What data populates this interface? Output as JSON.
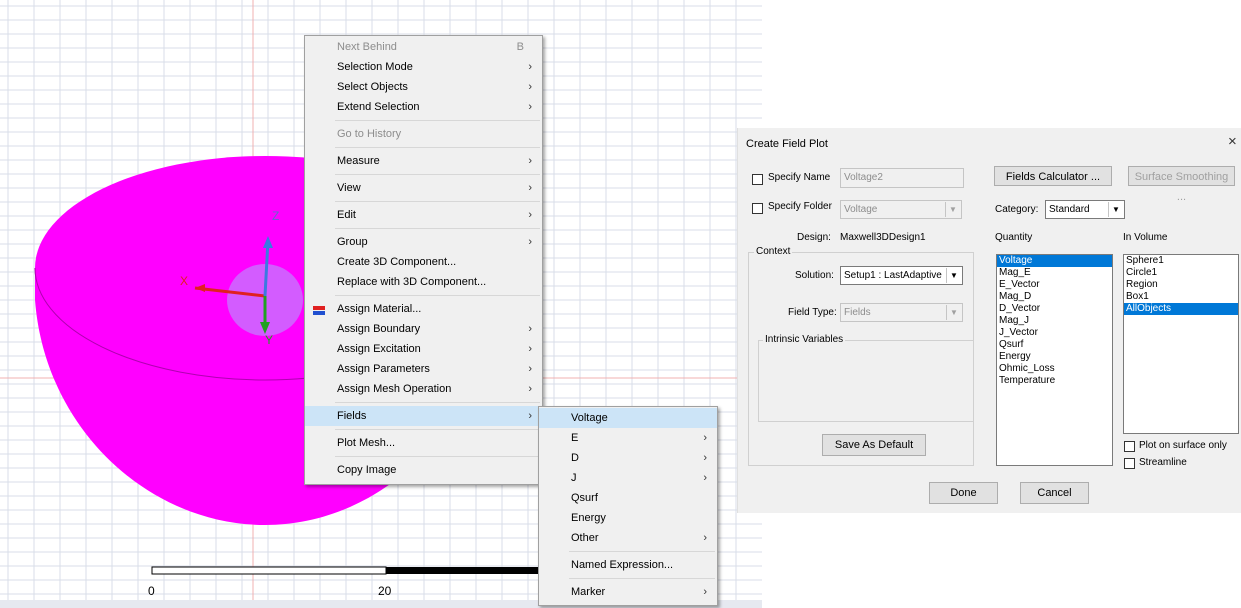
{
  "viewport": {
    "axis_labels": {
      "x": "X",
      "y": "Y",
      "z": "Z"
    },
    "scale_ticks": [
      "0",
      "20"
    ],
    "colors": {
      "object": "#ff00ff",
      "grid": "#d9dde8",
      "x_axis": "#e02020",
      "y_axis": "#20a020",
      "z_axis": "#3a7ae0"
    }
  },
  "context_menu": {
    "items": [
      {
        "label": "Next Behind",
        "shortcut": "B",
        "disabled": true
      },
      {
        "label": "Selection Mode",
        "submenu": true
      },
      {
        "label": "Select Objects",
        "submenu": true
      },
      {
        "label": "Extend Selection",
        "submenu": true
      },
      {
        "label": "Go to History",
        "disabled": true
      },
      {
        "label": "Measure",
        "submenu": true
      },
      {
        "label": "View",
        "submenu": true
      },
      {
        "label": "Edit",
        "submenu": true
      },
      {
        "label": "Group",
        "submenu": true
      },
      {
        "label": "Create 3D Component..."
      },
      {
        "label": "Replace with 3D Component..."
      },
      {
        "label": "Assign Material...",
        "icon": "material-icon"
      },
      {
        "label": "Assign Boundary",
        "submenu": true
      },
      {
        "label": "Assign Excitation",
        "submenu": true
      },
      {
        "label": "Assign Parameters",
        "submenu": true
      },
      {
        "label": "Assign Mesh Operation",
        "submenu": true
      },
      {
        "label": "Fields",
        "submenu": true,
        "highlighted": true
      },
      {
        "label": "Plot Mesh..."
      },
      {
        "label": "Copy Image"
      }
    ]
  },
  "fields_submenu": {
    "items": [
      {
        "label": "Voltage",
        "highlighted": true
      },
      {
        "label": "E",
        "submenu": true
      },
      {
        "label": "D",
        "submenu": true
      },
      {
        "label": "J",
        "submenu": true
      },
      {
        "label": "Qsurf"
      },
      {
        "label": "Energy"
      },
      {
        "label": "Other",
        "submenu": true
      },
      {
        "label": "Named Expression..."
      },
      {
        "label": "Marker",
        "submenu": true
      }
    ]
  },
  "dialog": {
    "title": "Create Field Plot",
    "close_glyph": "×",
    "specify_name_label": "Specify Name",
    "name_value": "Voltage2",
    "specify_folder_label": "Specify Folder",
    "folder_value": "Voltage",
    "fields_calculator_label": "Fields Calculator ...",
    "surface_smoothing_label": "Surface Smoothing ...",
    "category_label": "Category:",
    "category_value": "Standard",
    "design_label": "Design:",
    "design_value": "Maxwell3DDesign1",
    "context_label": "Context",
    "solution_label": "Solution:",
    "solution_value": "Setup1 : LastAdaptive",
    "field_type_label": "Field Type:",
    "field_type_value": "Fields",
    "intrinsic_label": "Intrinsic Variables",
    "save_default_label": "Save As Default",
    "quantity_label": "Quantity",
    "quantity_items": [
      "Voltage",
      "Mag_E",
      "E_Vector",
      "Mag_D",
      "D_Vector",
      "Mag_J",
      "J_Vector",
      "Qsurf",
      "Energy",
      "Ohmic_Loss",
      "Temperature"
    ],
    "quantity_selected": "Voltage",
    "in_volume_label": "In Volume",
    "volume_items": [
      "Sphere1",
      "Circle1",
      "Region",
      "Box1",
      "AllObjects"
    ],
    "volume_selected": "AllObjects",
    "plot_on_surface_label": "Plot on surface only",
    "streamline_label": "Streamline",
    "done_label": "Done",
    "cancel_label": "Cancel",
    "dropdown_glyph": "▼"
  }
}
